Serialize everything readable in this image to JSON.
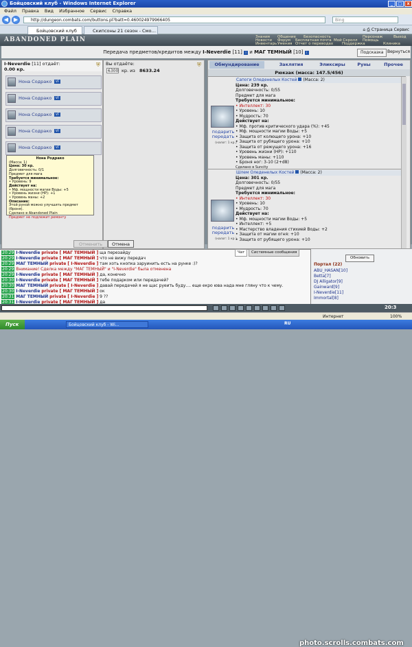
{
  "window": {
    "title": "Бойцовский клуб - Windows Internet Explorer",
    "minimize": "_",
    "maximize": "□",
    "close": "x"
  },
  "menu": [
    "Файл",
    "Правка",
    "Вид",
    "Избранное",
    "Сервис",
    "Справка"
  ],
  "address": {
    "url": "http://dungeon.combats.com/buttons.pl?batt=0.460024979966405",
    "search_placeholder": "Bing"
  },
  "tabs": [
    {
      "label": "Бойцовский клуб",
      "active": true
    },
    {
      "label": "Скипсоны 21 сезон - Смотр...",
      "active": false
    }
  ],
  "ie_tools": {
    "page": "Страница",
    "service": "Сервис"
  },
  "game": {
    "logo": "ABANDONED PLAIN",
    "top_menu": [
      [
        "Знания",
        "Общение",
        "Безопасность",
        "Персонаж",
        "Выход"
      ],
      [
        "Новости",
        "Форум",
        "Бесплатная почта",
        "Мой Скролл",
        "Помощь"
      ],
      [
        "Инвентарь",
        "Умения",
        "Отчет о переводах",
        "Поддержка",
        "Клиника"
      ]
    ],
    "heading": {
      "text_before": "Передача предметов/кредитов между",
      "user1": "I-Neverdie",
      "user1_level": "[11]",
      "and": "и",
      "user2": "МАГ ТЕМНЫЙ",
      "user2_level": "[10]",
      "help": "Подсказка",
      "back": "Вернуться"
    },
    "left": {
      "user": "I-Neverdie",
      "level": "[11]",
      "gives": "отдаёт:",
      "amount": "0.00 кр.",
      "slots": [
        "Нона Содрако",
        "Нона Содрако",
        "Нона Содрако",
        "Нона Содрако",
        "Нона Содрако"
      ],
      "badge": "VF"
    },
    "tooltip": {
      "title": "Нона Родрако",
      "lines": [
        "(Масса: 1)",
        "Цена: 30 кр.",
        "Долговечность: 0/1",
        "Предмет для мага",
        "Требуется минимальное:",
        "• Уровень: 9",
        "Действует на:",
        "• Мф. мощности магии Воды: +5",
        "• Уровень жизни (HP): +1",
        "• Уровень маны: +2",
        "Описание:",
        "Этой руной можно улучшить предмет (броня).",
        "Сделано в Abandoned Plain"
      ],
      "footer": "Предмет не подлежит ремонту"
    },
    "middle": {
      "gives": "Вы отдаёте:",
      "input_value": "6300",
      "of_label": "кр. из",
      "total": "8633.24",
      "cancel_trade": "Отменить",
      "cancel": "Отмена"
    },
    "right_tabs": [
      "Обмундирование",
      "Заклятия",
      "Эликсиры",
      "Руны",
      "Прочее"
    ],
    "backpack": "Рюкзак (масса: 147.5/456)",
    "items": [
      {
        "name": "Сапоги Оледенелых Костей",
        "mass": "(Масса: 2)",
        "give": "подарить",
        "give2": "передать",
        "tax": "(налог: 1 кр.)",
        "price": "Цена: 239 кр.",
        "lines": [
          "Долговечность: 0/55",
          "Предмет для мага",
          "Требуется минимальное:",
          "• Интеллект: 30",
          "• Уровень: 10",
          "• Мудрость: 70",
          "Действует на:",
          "• Мф. против критического удара (%): +45",
          "• Мф. мощности магии Воды: +5",
          "• Защита от колющего урона: +10",
          "• Защита от рубящего урона: +10",
          "• Защита от режущего урона: +16",
          "• Уровень жизни (HP): +110",
          "• Уровень маны: +110",
          "• Броня ног: 3-10 (2+d8)",
          "Сделано в Suncity"
        ]
      },
      {
        "name": "Шлем Оледенелых Костей",
        "mass": "(Масса: 2)",
        "give": "подарить",
        "give2": "передать",
        "tax": "(налог: 1 кр.)",
        "price": "Цена: 301 кр.",
        "lines": [
          "Долговечность: 0/55",
          "Предмет для мага",
          "Требуется минимальное:",
          "• Интеллект: 30",
          "• Уровень: 10",
          "• Мудрость: 70",
          "Действует на:",
          "• Мф. мощности магии Воды: +5",
          "• Интеллект: +5",
          "• Мастерство владения стихией Воды: +2",
          "• Защита от магии огня: +10",
          "• Защита от рубящего урона: +10"
        ]
      }
    ],
    "chat_tabs": [
      "Чат",
      "Системные сообщения"
    ],
    "chat": [
      {
        "time": "20:29",
        "from": "I-Neverdie",
        "pm": "private [ МАГ ТЕМНЫЙ ]",
        "msg": "ща перезайду"
      },
      {
        "time": "20:29",
        "from": "I-Neverdie",
        "pm": "private [ МАГ ТЕМНЫЙ ]",
        "msg": "что не вижу передач"
      },
      {
        "time": "20:29",
        "from": "МАГ ТЕМНЫЙ",
        "pm": "private [ I-Neverdie ]",
        "msg": "там хоть кнопка заруинить есть на рунке :)?"
      },
      {
        "time": "20:29",
        "from": "",
        "pm": "",
        "msg": "Внимание! Сделка между \"МАГ ТЕМНЫЙ\" и \"I-Neverdie\" была отменена"
      },
      {
        "time": "20:29",
        "from": "I-Neverdie",
        "pm": "private [ МАГ ТЕМНЫЙ ]",
        "msg": "да, конечно"
      },
      {
        "time": "20:30",
        "from": "I-Neverdie",
        "pm": "private [ МАГ ТЕМНЫЙ ]",
        "msg": "тебе подарком или передачей?"
      },
      {
        "time": "20:30",
        "from": "МАГ ТЕМНЫЙ",
        "pm": "private [ I-Neverdie ]",
        "msg": "давай передачей я не щас руеить буду.... еще екро юва нада мне гляну что к чему."
      },
      {
        "time": "20:30",
        "from": "I-Neverdie",
        "pm": "private [ МАГ ТЕМНЫЙ ]",
        "msg": "ок"
      },
      {
        "time": "20:31",
        "from": "МАГ ТЕМНЫЙ",
        "pm": "private [ I-Neverdie ]",
        "msg": "9 ??"
      },
      {
        "time": "20:31",
        "from": "I-Neverdie",
        "pm": "private [ МАГ ТЕМНЫЙ ]",
        "msg": "да"
      }
    ],
    "online": {
      "refresh": "Обновить",
      "location": "Портал (22)",
      "users": [
        "ABU_HASAN[10]",
        "Betta[7]",
        "DJ Alligator[9]",
        "Gainward[9]",
        "I-Neverdie[11]",
        "Immortal[8]"
      ]
    },
    "clock": "20:3",
    "lang": "RU"
  },
  "statusbar": {
    "zone": "Интернет",
    "zoom": "100%"
  },
  "taskbar": {
    "start": "Пуск",
    "task": "Бойцовский клуб - Wi..."
  },
  "watermark": "photo.scrolls.combats.com"
}
